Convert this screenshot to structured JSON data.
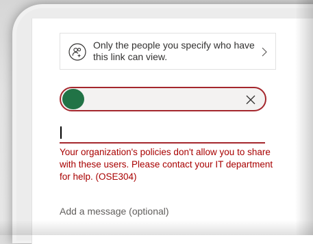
{
  "link_settings": {
    "description": "Only the people you specify who have this link can view.",
    "icon": "people-specific-icon",
    "chevron": "chevron-right-icon"
  },
  "recipient": {
    "avatar_color": "#217346",
    "remove_icon": "close-icon",
    "error_border_color": "#a4262c"
  },
  "name_input": {
    "value": ""
  },
  "error": {
    "message": "Your organization's policies don't allow you to share with these users. Please contact your IT department for help. (OSE304)",
    "color": "#a80000"
  },
  "message": {
    "placeholder": "Add a message (optional)"
  }
}
